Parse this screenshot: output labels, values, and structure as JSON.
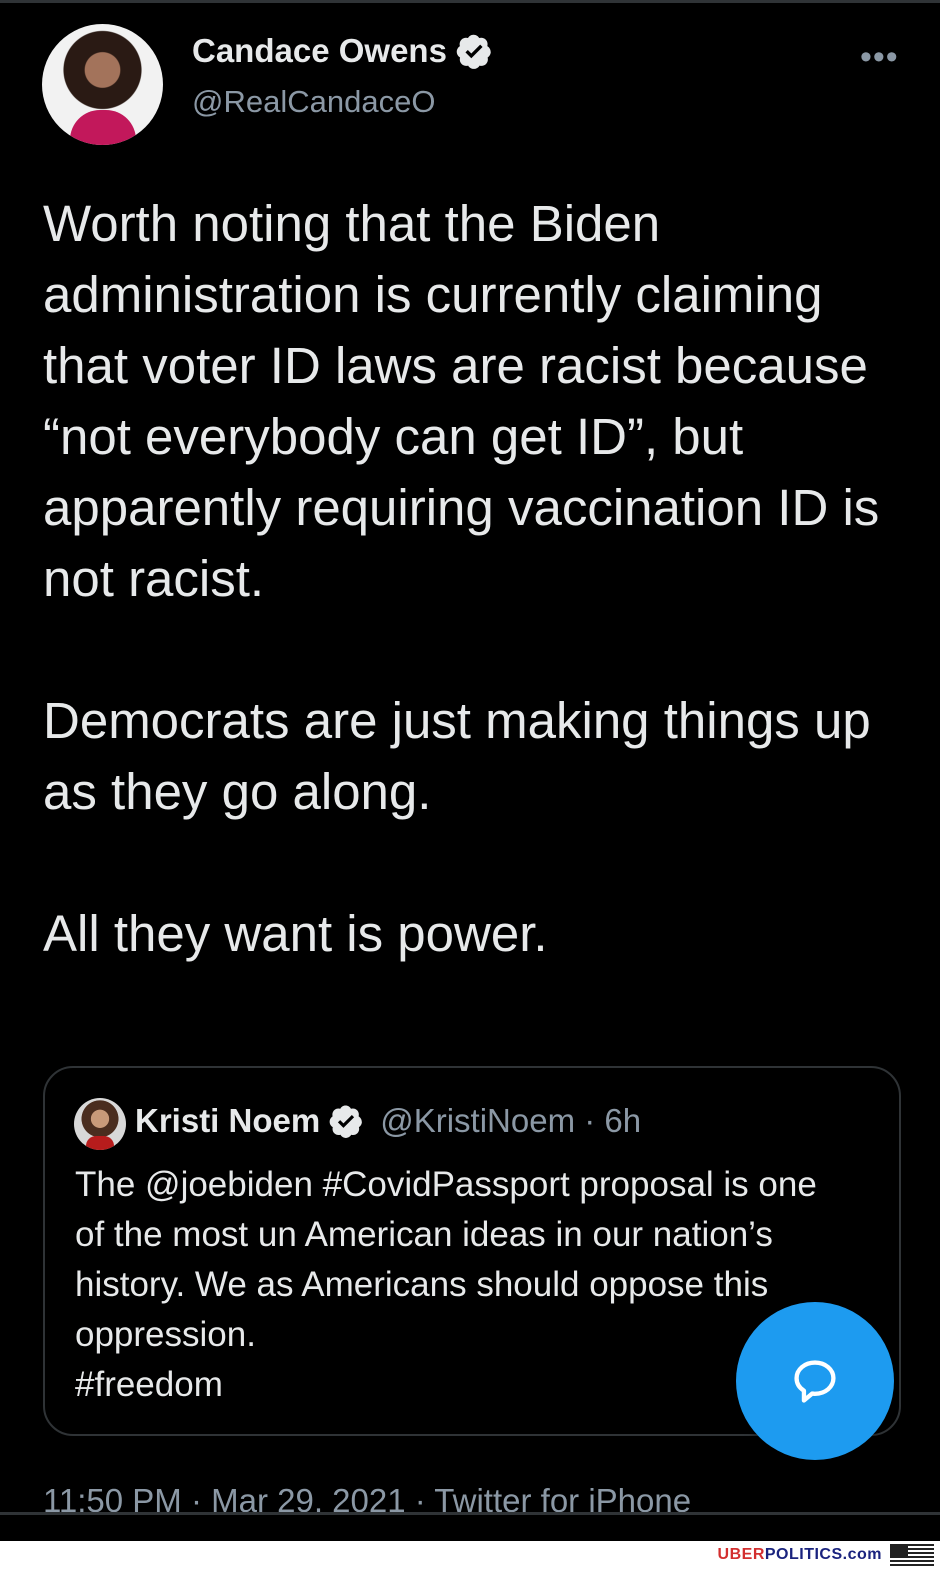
{
  "tweet": {
    "author_name": "Candace Owens",
    "author_handle": "@RealCandaceO",
    "more_label": "•••",
    "paragraphs": [
      "Worth noting that the Biden administration is currently claiming that voter ID laws are racist because “not everybody can get ID”, but apparently requiring vaccination ID is not racist.",
      "Democrats are just making things up as they go along.",
      "All they want is power."
    ],
    "meta": "11:50 PM · Mar 29, 2021 · Twitter for iPhone"
  },
  "quoted_tweet": {
    "author_name": "Kristi Noem",
    "author_handle": "@KristiNoem · 6h",
    "lines": [
      "The @joebiden #CovidPassport proposal is one",
      "of the most un American ideas in our nation’s",
      "history.  We as Americans should oppose this",
      "oppression.",
      "#freedom"
    ]
  },
  "fab": {
    "icon": "reply-bubble-icon",
    "color": "#1d9bf0"
  },
  "watermark": {
    "part1": "UBER",
    "part2": "POLITICS",
    "part3": ".com"
  },
  "colors": {
    "background": "#000000",
    "text": "#e7e9ea",
    "muted": "#8b98a5",
    "accent": "#1d9bf0"
  }
}
